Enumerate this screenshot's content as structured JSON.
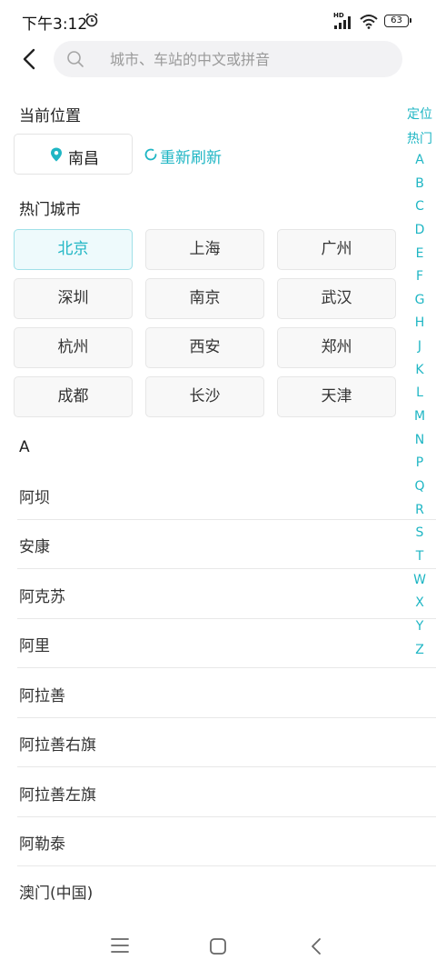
{
  "status_bar": {
    "time": "下午3:12",
    "network_badge": "HD",
    "battery": "63",
    "icons": [
      "alarm-icon",
      "signal-icon",
      "wifi-icon",
      "battery-icon"
    ]
  },
  "header": {
    "back_icon": "chevron-left-icon",
    "search_icon": "search-icon",
    "search_placeholder": "城市、车站的中文或拼音",
    "search_value": ""
  },
  "current_location": {
    "title": "当前位置",
    "city": "南昌",
    "refresh_label": "重新刷新"
  },
  "hot_cities": {
    "title": "热门城市",
    "items": [
      "北京",
      "上海",
      "广州",
      "深圳",
      "南京",
      "武汉",
      "杭州",
      "西安",
      "郑州",
      "成都",
      "长沙",
      "天津"
    ],
    "selected": "北京"
  },
  "city_list": {
    "group": "A",
    "items": [
      "阿坝",
      "安康",
      "阿克苏",
      "阿里",
      "阿拉善",
      "阿拉善右旗",
      "阿拉善左旗",
      "阿勒泰",
      "澳门(中国)"
    ]
  },
  "index_bar": [
    "定位",
    "热门",
    "A",
    "B",
    "C",
    "D",
    "E",
    "F",
    "G",
    "H",
    "J",
    "K",
    "L",
    "M",
    "N",
    "P",
    "Q",
    "R",
    "S",
    "T",
    "W",
    "X",
    "Y",
    "Z"
  ],
  "colors": {
    "accent": "#1fb6c4",
    "selected_bg": "#eefafc",
    "search_bg": "#f2f2f4"
  }
}
